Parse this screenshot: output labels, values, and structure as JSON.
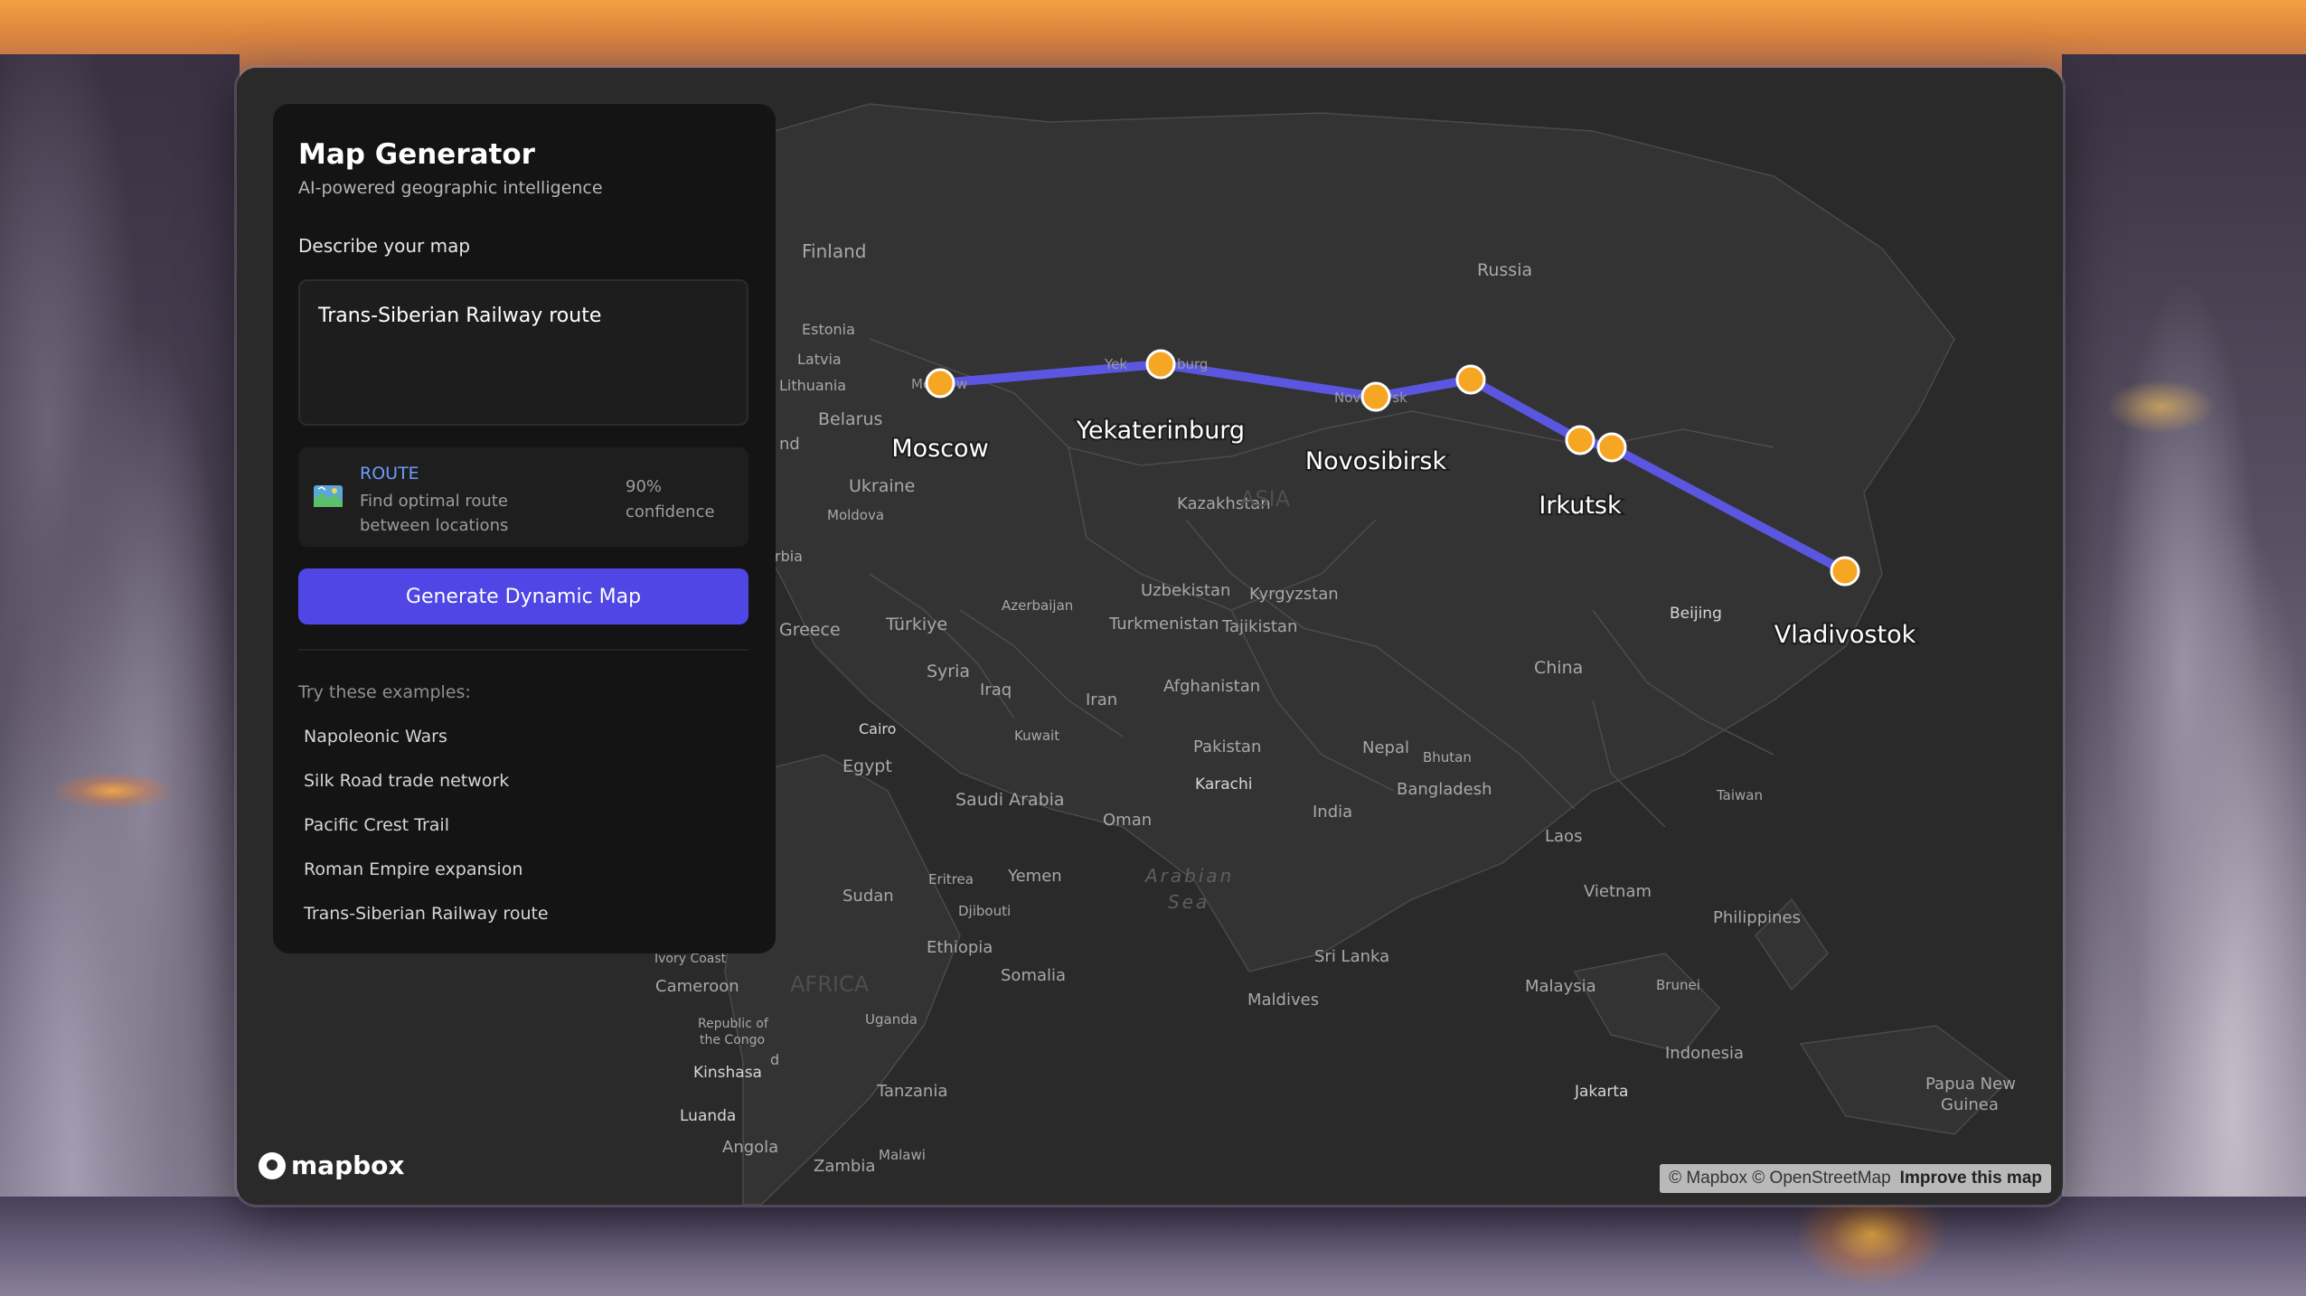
{
  "panel": {
    "title": "Map Generator",
    "subtitle": "AI-powered geographic intelligence",
    "prompt_label": "Describe your map",
    "prompt_value": "Trans-Siberian Railway route",
    "analysis": {
      "type": "ROUTE",
      "description": "Find optimal route between locations",
      "confidence": "90% confidence",
      "icon": "map-icon"
    },
    "generate_button": "Generate Dynamic Map",
    "examples_label": "Try these examples:",
    "examples": [
      "Napoleonic Wars",
      "Silk Road trade network",
      "Pacific Crest Trail",
      "Roman Empire expansion",
      "Trans-Siberian Railway route"
    ]
  },
  "map": {
    "route_color": "#5b56e0",
    "marker_color": "#f5a623",
    "stops": [
      {
        "label": "Moscow"
      },
      {
        "label": "Yekaterinburg"
      },
      {
        "label": "Novosibirsk"
      },
      {
        "label": ""
      },
      {
        "label": "Irkutsk"
      },
      {
        "label": ""
      },
      {
        "label": "Vladivostok"
      }
    ],
    "base_labels": [
      "Finland",
      "Russia",
      "Estonia",
      "Latvia",
      "Lithuania",
      "Belarus",
      "Ukraine",
      "Moldova",
      "Kazakhstan",
      "Uzbekistan",
      "Kyrgyzstan",
      "Turkmenistan",
      "Tajikistan",
      "Azerbaijan",
      "Greece",
      "Türkiye",
      "Syria",
      "Iraq",
      "Iran",
      "Afghanistan",
      "Kuwait",
      "Cairo",
      "Egypt",
      "Saudi Arabia",
      "Oman",
      "Pakistan",
      "Karachi",
      "Nepal",
      "Bhutan",
      "Bangladesh",
      "India",
      "China",
      "Beijing",
      "Taiwan",
      "Laos",
      "Vietnam",
      "Philippines",
      "Yemen",
      "Eritrea",
      "Djibouti",
      "Ethiopia",
      "Sudan",
      "Somalia",
      "Arabian",
      "Sea",
      "Sri Lanka",
      "Maldives",
      "Malaysia",
      "Brunei",
      "Indonesia",
      "Jakarta",
      "Papua New",
      "Guinea",
      "Cameroon",
      "Republic of",
      "the Congo",
      "Uganda",
      "Kinshasa",
      "Tanzania",
      "Luanda",
      "Angola",
      "Zambia",
      "Malawi",
      "Ivory Coast",
      "ASIA",
      "AFRICA",
      "Mo",
      "w",
      "Yek",
      "burg",
      "Nov",
      "irsk",
      "rbia",
      "nd",
      "d"
    ]
  },
  "logo": "mapbox",
  "attribution": {
    "text": "© Mapbox © OpenStreetMap",
    "link": "Improve this map"
  }
}
